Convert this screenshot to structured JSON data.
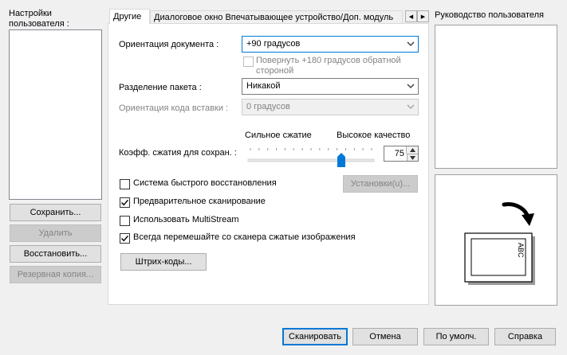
{
  "left_panel": {
    "title": "Настройки пользователя :",
    "buttons": {
      "save": "Сохранить...",
      "delete": "Удалить",
      "restore": "Восстановить...",
      "backup": "Резервная копия..."
    }
  },
  "tabs": [
    {
      "label": "Другие",
      "active": true
    },
    {
      "label": "Диалоговое окно Впечатывающее устройство/Доп. модуль",
      "active": false
    }
  ],
  "form": {
    "orientation": {
      "label": "Ориентация документа :",
      "value": "+90 градусов"
    },
    "rotate180": {
      "label": "Повернуть +180 градусов обратной стороной",
      "checked": false,
      "disabled": true
    },
    "batch_split": {
      "label": "Разделение пакета :",
      "value": "Никакой"
    },
    "imprint_orientation": {
      "label": "Ориентация кода вставки :",
      "value": "0 градусов",
      "disabled": true
    },
    "compression": {
      "label": "Коэфф. сжатия для сохран. :",
      "left_caption": "Сильное сжатие",
      "right_caption": "Высокое качество",
      "value": "75",
      "slider_fraction": 0.75
    },
    "quick_recovery": {
      "label": "Система быстрого восстановления",
      "checked": false
    },
    "settings_button": "Установки(u)...",
    "prescan": {
      "label": "Предварительное сканирование",
      "checked": true
    },
    "multistream": {
      "label": "Использовать MultiStream",
      "checked": false
    },
    "always_rotate": {
      "label": "Всегда перемешайте со сканера сжатые изображения",
      "checked": true
    },
    "barcodes_button": "Штрих-коды..."
  },
  "right_panel": {
    "title": "Руководство пользователя",
    "preview_text": "ABC"
  },
  "footer": {
    "scan": "Сканировать",
    "cancel": "Отмена",
    "defaults": "По умолч.",
    "help": "Справка"
  },
  "colors": {
    "accent": "#0078d7",
    "slider_thumb": "#0078d7"
  }
}
